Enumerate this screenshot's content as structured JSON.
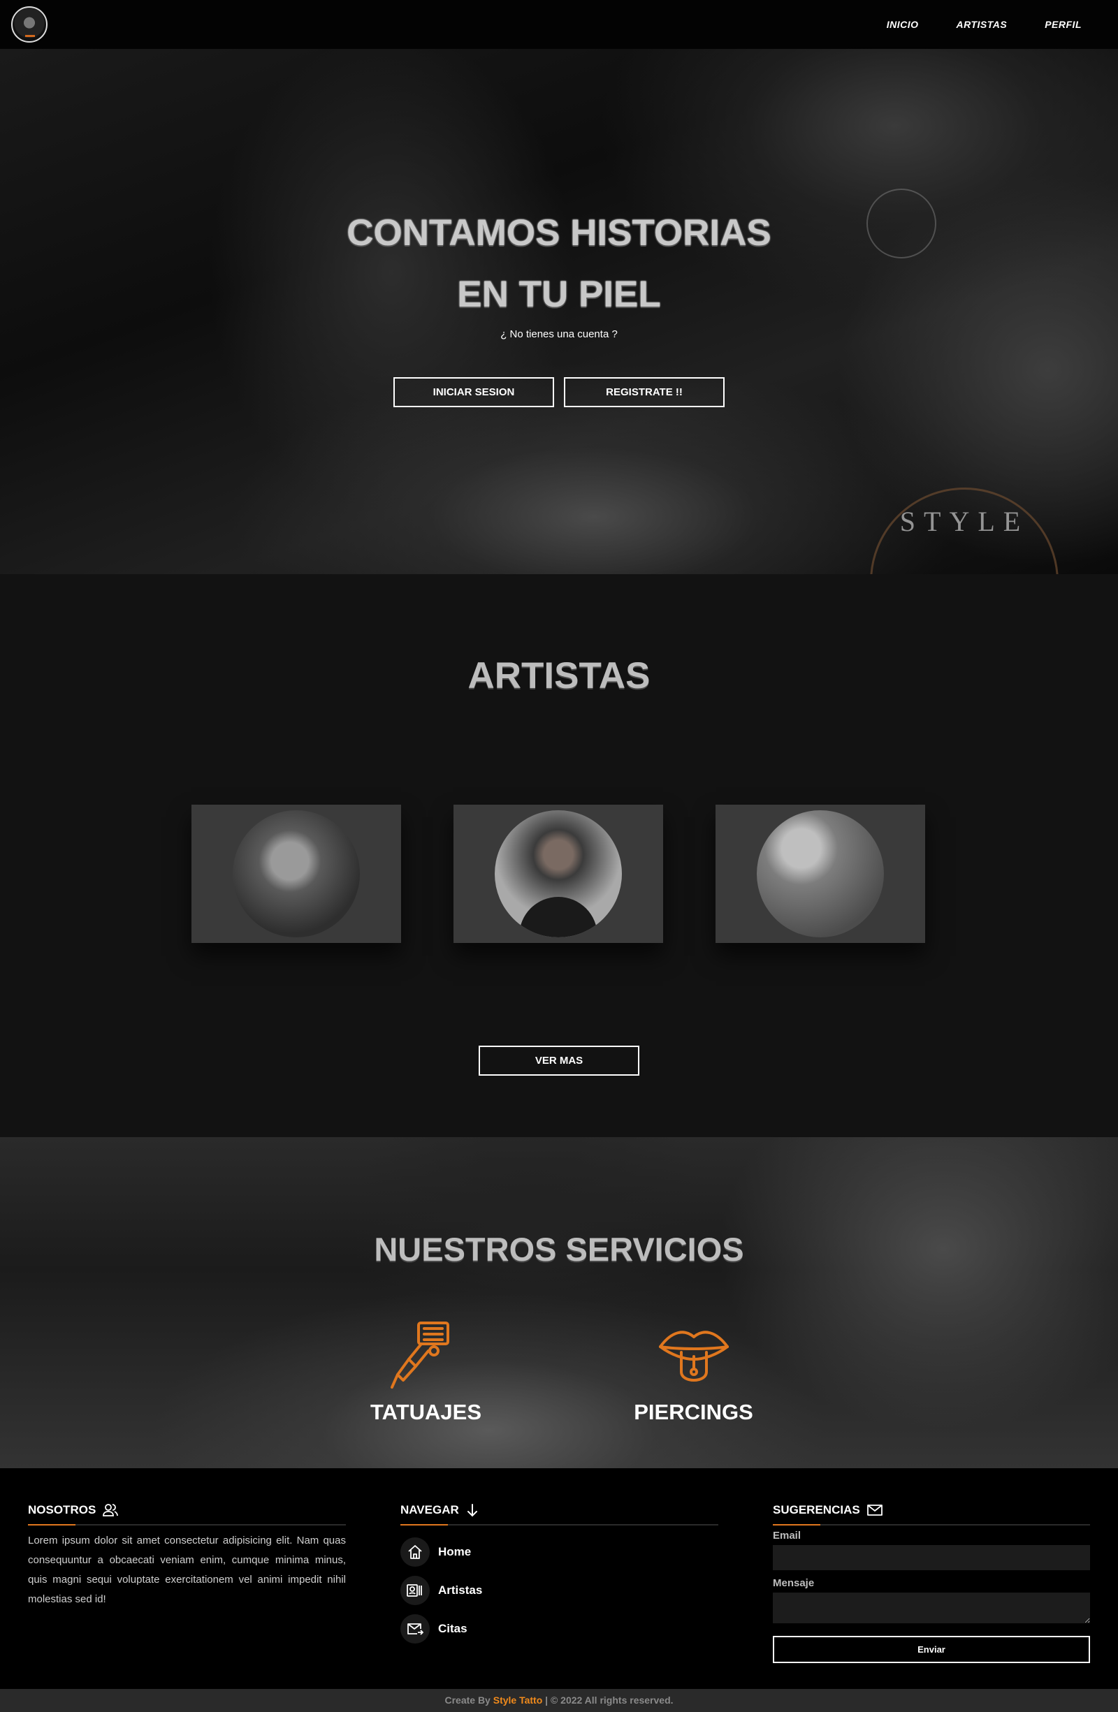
{
  "nav": {
    "logo_icon": "style-tattoo-logo-icon",
    "links": [
      "INICIO",
      "ARTISTAS",
      "PERFIL"
    ]
  },
  "hero": {
    "title_line1": "CONTAMOS HISTORIAS",
    "title_line2": "EN TU PIEL",
    "subtitle": "¿ No tienes una cuenta ?",
    "login_button": "INICIAR SESION",
    "register_button": "REGISTRATE !!",
    "stamp_text": "STYLE"
  },
  "artists": {
    "title": "ARTISTAS",
    "cards": [
      {
        "avatar_icon": "artist-1-photo"
      },
      {
        "avatar_icon": "artist-2-photo"
      },
      {
        "avatar_icon": "artist-3-photo"
      }
    ],
    "more_button": "VER MAS"
  },
  "services": {
    "title": "NUESTROS SERVICIOS",
    "items": [
      {
        "label": "TATUAJES",
        "icon": "tattoo-machine-icon"
      },
      {
        "label": "PIERCINGS",
        "icon": "pierced-tongue-icon"
      }
    ],
    "accent_color": "#e0771e"
  },
  "footer": {
    "about": {
      "heading": "NOSOTROS",
      "icon": "users-icon",
      "text": "Lorem ipsum dolor sit amet consectetur adipisicing elit. Nam quas consequuntur a obcaecati veniam enim, cumque minima minus, quis magni sequi voluptate exercitationem vel animi impedit nihil molestias sed id!"
    },
    "navigate": {
      "heading": "NAVEGAR",
      "icon": "arrow-down-icon",
      "items": [
        {
          "label": "Home",
          "icon": "home-icon"
        },
        {
          "label": "Artistas",
          "icon": "artists-icon"
        },
        {
          "label": "Citas",
          "icon": "mail-send-icon"
        }
      ]
    },
    "suggestions": {
      "heading": "SUGERENCIAS",
      "icon": "mail-icon",
      "email_label": "Email",
      "email_value": "",
      "message_label": "Mensaje",
      "message_value": "",
      "send_button": "Enviar"
    },
    "accent_color": "#e0771e"
  },
  "copyright": {
    "prefix": "Create By",
    "brand": "Style Tatto",
    "suffix": "| © 2022 All rights reserved."
  }
}
